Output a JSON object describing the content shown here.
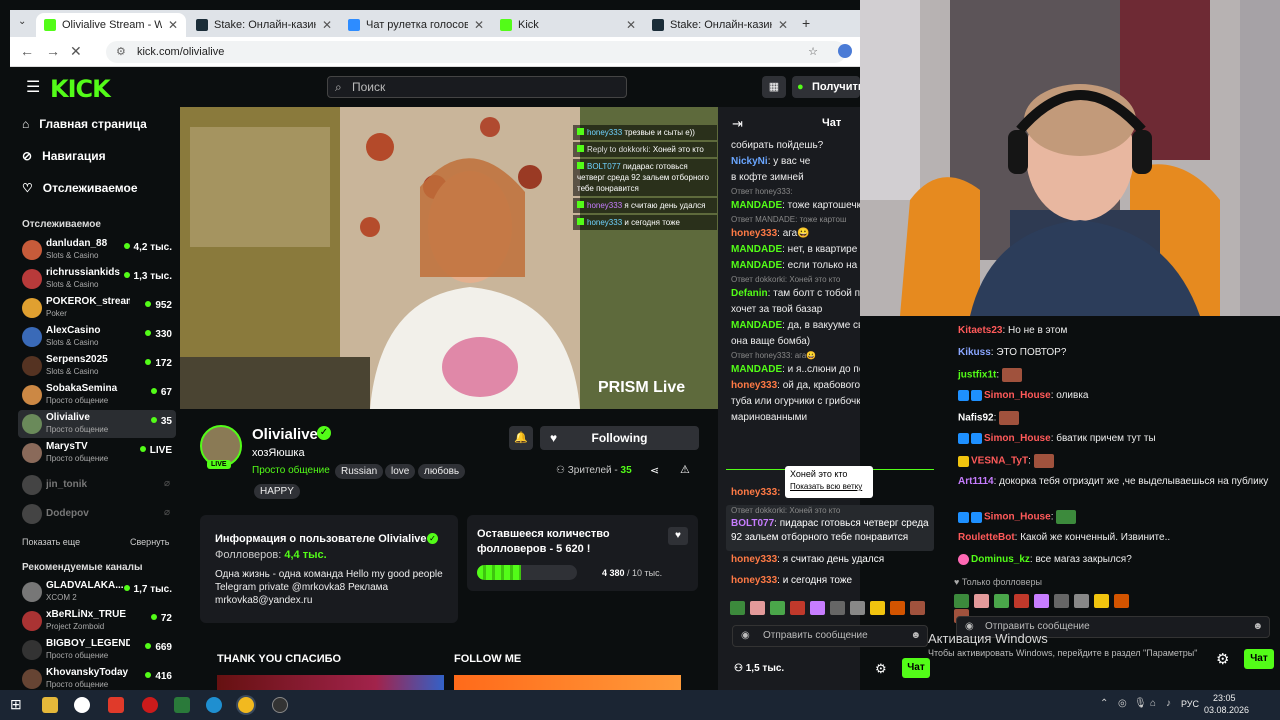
{
  "browser": {
    "tabs": [
      {
        "title": "Olivialive Stream - Watch Live",
        "fav": "#53fc18",
        "active": true
      },
      {
        "title": "Stake: Онлайн-казино и став",
        "fav": "#1a2c38",
        "active": false
      },
      {
        "title": "Чат рулетка голосовая — Ne",
        "fav": "#2d8cff",
        "active": false
      },
      {
        "title": "Kick",
        "fav": "#53fc18",
        "active": false
      },
      {
        "title": "Stake: Онлайн-казино и став",
        "fav": "#1a2c38",
        "active": false
      }
    ],
    "url": "kick.com/olivialive"
  },
  "header": {
    "logo": "KICK",
    "search_placeholder": "Поиск",
    "get_label": "Получить I"
  },
  "sidebar": {
    "nav": [
      "Главная страница",
      "Навигация",
      "Отслеживаемое"
    ],
    "following_title": "Отслеживаемое",
    "following": [
      {
        "name": "danludan_88",
        "cat": "Slots & Casino",
        "viewers": "4,2 тыс.",
        "color": "#c75b3a"
      },
      {
        "name": "richrussiankids",
        "cat": "Slots & Casino",
        "viewers": "1,3 тыс.",
        "color": "#b83a3a"
      },
      {
        "name": "POKEROK_streams",
        "cat": "Poker",
        "viewers": "952",
        "color": "#e0a030"
      },
      {
        "name": "AlexCasino",
        "cat": "Slots & Casino",
        "viewers": "330",
        "color": "#3a6ab8"
      },
      {
        "name": "Serpens2025",
        "cat": "Slots & Casino",
        "viewers": "172",
        "color": "#553322"
      },
      {
        "name": "SobakaSemina",
        "cat": "Просто общение",
        "viewers": "67",
        "color": "#cc8844"
      },
      {
        "name": "Olivialive",
        "cat": "Просто общение",
        "viewers": "35",
        "color": "#6a8a5a"
      },
      {
        "name": "MarysTV",
        "cat": "Просто общение",
        "viewers": "LIVE",
        "color": "#8a6a5a"
      }
    ],
    "offline": [
      "jin_tonik",
      "Dodepov"
    ],
    "show_more": "Показать еще",
    "collapse": "Свернуть",
    "recommended_title": "Рекомендуемые каналы",
    "recommended": [
      {
        "name": "GLADVALAKA...",
        "cat": "XCOM 2",
        "viewers": "1,7 тыс.",
        "color": "#777777"
      },
      {
        "name": "xBeRLiNx_TRUE",
        "cat": "Project Zomboid",
        "viewers": "72",
        "color": "#aa3333"
      },
      {
        "name": "BIGBOY_LEGENDAA",
        "cat": "Просто общение",
        "viewers": "669",
        "color": "#333333"
      },
      {
        "name": "KhovanskyToday",
        "cat": "Просто общение",
        "viewers": "416",
        "color": "#664433"
      }
    ]
  },
  "video": {
    "watermark": "PRISM Live",
    "overlay_chat": [
      {
        "user": "honey333",
        "text": "трезвые и сыты е))",
        "color": "#6fd3ff"
      },
      {
        "user": "Reply to dokkorki:",
        "text": "Хоней это кто",
        "color": "#dddddd"
      },
      {
        "user": "BOLT077",
        "text": "пидарас готовься четверг среда 92 зальем отборного тебе понравится",
        "color": "#6fd3ff"
      },
      {
        "user": "honey333",
        "text": "я считаю день удался",
        "color": "#c77dff"
      },
      {
        "user": "honey333",
        "text": "и сегодня тоже",
        "color": "#6fd3ff"
      }
    ]
  },
  "stream": {
    "name": "Olivialive",
    "title": "хозЯюшка",
    "category": "Просто общение",
    "tags": [
      "Russian",
      "love",
      "любовь",
      "HAPPY"
    ],
    "follow_label": "Following",
    "viewers_label": "Зрителей -",
    "viewers": "35",
    "live": "LIVE",
    "about_title": "Информация о пользователе Olivialive",
    "followers_label": "Фолловеров:",
    "followers": "4,4 тыс.",
    "bio": "Одна жизнь - одна команда Hello my good people   Telegram private @mrkovka8 Реклама mrkovka8@yandex.ru",
    "goal_title": "Оставшееся количество фолловеров - 5 620 !",
    "goal_count": "4 380",
    "goal_total": "/ 10 тыс.",
    "goal_progress": 0.438,
    "panel1": "THANK YOU СПАСИБО",
    "panel2": "FOLLOW ME"
  },
  "chat": {
    "title": "Чат",
    "messages": [
      {
        "reply": "",
        "user": "",
        "text": "собирать пойдешь?",
        "color": "#ffffff"
      },
      {
        "reply": "",
        "user": "NickyNi",
        "text": ": у вас че",
        "color": "#6aa6ff"
      },
      {
        "reply": "",
        "user": "",
        "text": "в кофте зимней",
        "color": "#ffffff"
      },
      {
        "reply": "Ответ honey333:",
        "user": "MANDADE",
        "text": ": тоже картошечк",
        "color": "#53fc18"
      },
      {
        "reply": "Ответ MANDADE: тоже картош",
        "user": "honey333",
        "text": ": ага😀",
        "color": "#ff7a45"
      },
      {
        "reply": "",
        "user": "MANDADE",
        "text": ": нет, в квартире",
        "color": "#53fc18"
      },
      {
        "reply": "",
        "user": "MANDADE",
        "text": ": если только на б",
        "color": "#53fc18"
      },
      {
        "reply": "Ответ dokkorki: Хоней это кто",
        "user": "Defanin",
        "text": ": там болт с тобой поговорить",
        "color": "#53fc18"
      },
      {
        "reply": "",
        "user": "",
        "text": "хочет за твой базар",
        "color": "#ffffff"
      },
      {
        "reply": "",
        "user": "MANDADE",
        "text": ": да, в вакууме свеклы возьми,",
        "color": "#53fc18"
      },
      {
        "reply": "",
        "user": "",
        "text": "она ваще бомба)",
        "color": "#ffffff"
      },
      {
        "reply": "Ответ honey333: ага😀",
        "user": "MANDADE",
        "text": ": и я..слюни до пола",
        "color": "#53fc18"
      },
      {
        "reply": "",
        "user": "honey333",
        "text": ": ой да, крабового салатика бы",
        "color": "#ff7a45"
      },
      {
        "reply": "",
        "user": "",
        "text": "туба или огурчики с грибочками",
        "color": "#ffffff"
      },
      {
        "reply": "",
        "user": "",
        "text": "маринованными",
        "color": "#ffffff"
      }
    ],
    "tooltip_text": "Хоней это кто",
    "tooltip_link": "Показать всю ветку",
    "honey_partial": "honey333:",
    "reply_bolt": "Ответ dokkorki: Хоней это кто",
    "bolt_user": "BOLT077",
    "bolt_text": ": пидарас готовься четверг среда",
    "bolt_text2": "92 зальем отборного тебе понравится",
    "m_last1_user": "honey333",
    "m_last1_text": ": я считаю день удался",
    "m_last2_user": "honey333",
    "m_last2_text": ": и сегодня тоже",
    "send_placeholder": "Отправить сообщение",
    "viewers": "1,5 тыс.",
    "chat_button": "Чат"
  },
  "chat2": {
    "messages": [
      {
        "user": "Kitaets23",
        "text": ": Но не в этом",
        "color": "#ff5a5a"
      },
      {
        "user": "Kikuss",
        "text": ": ЭТО ПОВТОР?",
        "color": "#8aa6ff"
      },
      {
        "user": "justfix1t",
        "text": ":",
        "color": "#53fc18"
      },
      {
        "user": "Simon_House",
        "text": ": оливка",
        "color": "#ff5a5a"
      },
      {
        "user": "Nafis92",
        "text": ":",
        "color": "#ffffff"
      },
      {
        "user": "Simon_House",
        "text": ": бватик причем тут ты",
        "color": "#ff5a5a"
      },
      {
        "user": "VESNA_TyT",
        "text": ":",
        "color": "#ff5a5a"
      },
      {
        "user": "Art1114",
        "text": ": докорка тебя отриздит же ,че выделываешься на публику",
        "color": "#c77dff"
      },
      {
        "user": "Simon_House",
        "text": ":",
        "color": "#ff5a5a"
      },
      {
        "user": "RouletteBot",
        "text": ": Какой же конченный. Извините..",
        "color": "#ff5a5a"
      },
      {
        "user": "Dominus_kz",
        "text": ": все магаз закрылся?",
        "color": "#53fc18"
      }
    ],
    "followers_only": "Только фолловеры",
    "send_placeholder": "Отправить сообщение",
    "chat_button": "Чат",
    "activation_title": "Активация Windows",
    "activation_text": "Чтобы активировать Windows, перейдите в раздел \"Параметры\""
  },
  "taskbar": {
    "lang": "РУС",
    "time": "23:05",
    "date": "03.08.2026"
  }
}
